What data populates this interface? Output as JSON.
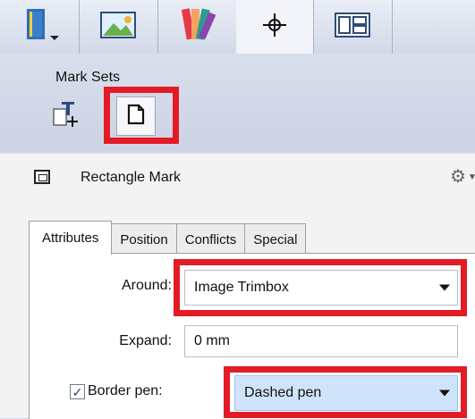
{
  "toolbar": {
    "tabs": [
      {
        "icon": "book-icon"
      },
      {
        "icon": "image-icon"
      },
      {
        "icon": "color-swatch-icon"
      },
      {
        "icon": "crosshair-icon"
      },
      {
        "icon": "layout-icon"
      }
    ]
  },
  "mark_sets": {
    "title": "Mark Sets",
    "buttons": [
      {
        "icon": "text-mark-icon"
      },
      {
        "icon": "page-mark-icon"
      }
    ]
  },
  "mark": {
    "title": "Rectangle Mark"
  },
  "tabs": [
    "Attributes",
    "Position",
    "Conflicts",
    "Special"
  ],
  "attributes": {
    "around_label": "Around:",
    "around_value": "Image Trimbox",
    "expand_label": "Expand:",
    "expand_value": "0 mm",
    "border_pen_label": "Border pen:",
    "border_pen_checked": true,
    "border_pen_value": "Dashed pen"
  },
  "colors": {
    "highlight_red": "#e21b26",
    "dropdown_selected": "#cfe4fb"
  }
}
